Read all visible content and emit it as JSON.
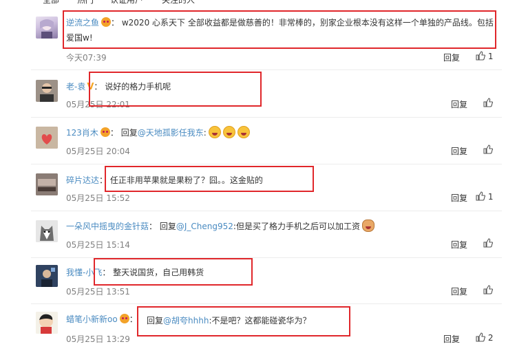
{
  "topbar": {
    "items": [
      "全部",
      "热门",
      "认证用户",
      "关注的人"
    ]
  },
  "ui": {
    "reply_label": "回复"
  },
  "comments": [
    {
      "user": "逆流之鱼",
      "badge": "crown",
      "text": "w2020 心系天下 全部收益都是做慈善的！非常棒的，别家企业根本没有这样一个单独的产品线。包括爱国w!",
      "time": "今天07:39",
      "likes": "1"
    },
    {
      "user": "老-袁",
      "badge": "v",
      "text": "说好的格力手机呢",
      "time": "05月25日 22:01",
      "likes": ""
    },
    {
      "user": "123肖木",
      "badge": "crown",
      "prefix": "回复",
      "mention": "@天地孤影任我东",
      "text": ":",
      "emoji_count": 3,
      "time": "05月25日 20:04",
      "likes": ""
    },
    {
      "user": "碎片达达",
      "badge": "",
      "text": "任正非用苹果就是果粉了？囧。。这金贴的",
      "time": "05月25日 15:52",
      "likes": "1"
    },
    {
      "user": "一朵风中摇曳的金针菇",
      "badge": "",
      "prefix": "回复",
      "mention": "@J_Cheng952",
      "text": ":但是买了格力手机之后可以加工资",
      "time": "05月25日 15:14",
      "likes": ""
    },
    {
      "user": "我懂-小飞",
      "badge": "",
      "text": "整天说国货，自己用韩货",
      "time": "05月25日 13:51",
      "likes": ""
    },
    {
      "user": "蜡笔小新新oo",
      "badge": "crown",
      "prefix": "回复",
      "mention": "@胡夸hhhh",
      "text": ":不是吧？这都能碰瓷华为？",
      "time": "05月25日 13:29",
      "likes": "2"
    }
  ],
  "colors": {
    "username": "#eb7350",
    "link": "#4a8bc1",
    "highlight_box": "#e0262a"
  }
}
